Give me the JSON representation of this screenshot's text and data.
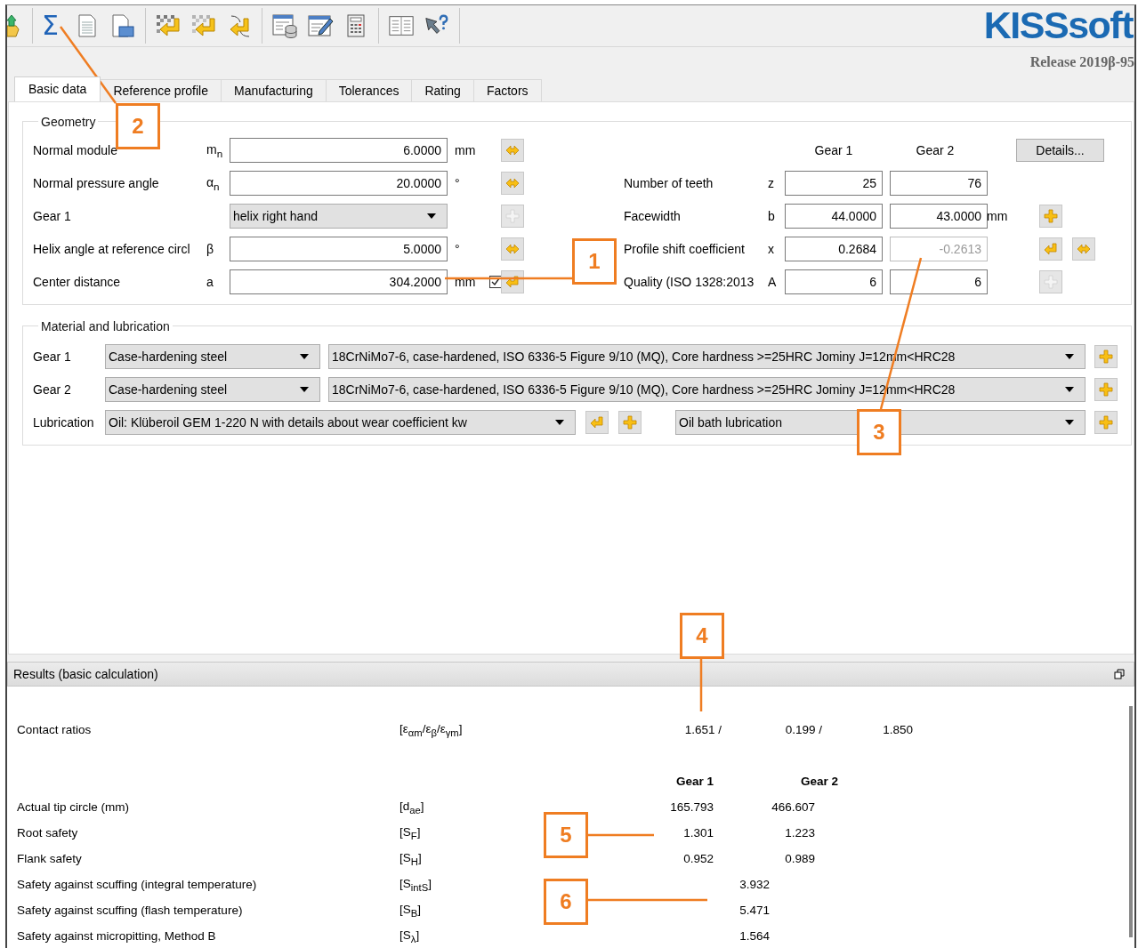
{
  "toolbar": [
    {
      "kind": "upload"
    },
    {
      "kind": "separator"
    },
    {
      "kind": "text",
      "text": "Σ"
    },
    {
      "kind": "document"
    },
    {
      "kind": "save"
    },
    {
      "kind": "separator"
    },
    {
      "kind": "import-checker"
    },
    {
      "kind": "import-fade"
    },
    {
      "kind": "return-curve"
    },
    {
      "kind": "separator"
    },
    {
      "kind": "database"
    },
    {
      "kind": "edit"
    },
    {
      "kind": "calculator"
    },
    {
      "kind": "separator"
    },
    {
      "kind": "book"
    },
    {
      "kind": "help"
    }
  ],
  "logo": "KISSsoft",
  "release": "Release 2019β-95",
  "tabs": [
    {
      "label": "Basic data",
      "selected": true
    },
    {
      "label": "Reference profile",
      "selected": false
    },
    {
      "label": "Manufacturing",
      "selected": false
    },
    {
      "label": "Tolerances",
      "selected": false
    },
    {
      "label": "Rating",
      "selected": false
    },
    {
      "label": "Factors",
      "selected": false
    }
  ],
  "geometry": {
    "legend": "Geometry",
    "left": [
      {
        "label": "Normal module",
        "symbol": "m$_{n}$",
        "kind": "input",
        "value": "6.0000",
        "unit": "mm",
        "button": {
          "kind": "swap",
          "disabled": false
        }
      },
      {
        "label": "Normal pressure angle",
        "symbol": "α$_{n}$",
        "kind": "input",
        "value": "20.0000",
        "unit": "°",
        "button": {
          "kind": "swap",
          "disabled": false
        }
      },
      {
        "label": "Gear 1",
        "kind": "select",
        "value": "helix right hand",
        "button": {
          "kind": "plus",
          "disabled": true
        }
      },
      {
        "label": "Helix angle at reference circl",
        "symbol": "β",
        "kind": "input",
        "value": "5.0000",
        "unit": "°",
        "button": {
          "kind": "swap",
          "disabled": false
        }
      },
      {
        "label": "Center distance",
        "symbol": "a",
        "kind": "input",
        "value": "304.2000",
        "unit": "mm",
        "checkbox": {
          "checked": true
        },
        "button": {
          "kind": "return",
          "disabled": false
        }
      }
    ],
    "columns": [
      "Gear 1",
      "Gear 2"
    ],
    "details": "Details...",
    "right": [
      {
        "label": "Number of teeth",
        "symbol": "z",
        "values": [
          {
            "text": "25",
            "disabled": false
          },
          {
            "text": "76",
            "disabled": false
          }
        ]
      },
      {
        "label": "Facewidth",
        "symbol": "b",
        "values": [
          {
            "text": "44.0000",
            "disabled": false
          },
          {
            "text": "43.0000",
            "disabled": false
          }
        ],
        "unit": "mm",
        "buttons": [
          {
            "kind": "plus",
            "disabled": false
          }
        ]
      },
      {
        "label": "Profile shift coefficient",
        "symbol": "x",
        "values": [
          {
            "text": "0.2684",
            "disabled": false
          },
          {
            "text": "-0.2613",
            "disabled": true
          }
        ],
        "buttons": [
          {
            "kind": "return",
            "disabled": false
          },
          {
            "kind": "swap",
            "disabled": false
          }
        ]
      },
      {
        "label": "Quality (ISO 1328:2013",
        "symbol": "A",
        "values": [
          {
            "text": "6",
            "disabled": false
          },
          {
            "text": "6",
            "disabled": false
          }
        ],
        "buttons": [
          {
            "kind": "plus",
            "disabled": true
          }
        ]
      }
    ]
  },
  "material": {
    "legend": "Material and lubrication",
    "rows": [
      {
        "label": "Gear 1",
        "kind": "material",
        "selects": [
          "Case-hardening steel",
          "18CrNiMo7-6, case-hardened, ISO 6336-5 Figure 9/10 (MQ), Core hardness >=25HRC Jominy J=12mm<HRC28"
        ]
      },
      {
        "label": "Gear 2",
        "kind": "material",
        "selects": [
          "Case-hardening steel",
          "18CrNiMo7-6, case-hardened, ISO 6336-5 Figure 9/10 (MQ), Core hardness >=25HRC Jominy J=12mm<HRC28"
        ]
      },
      {
        "label": "Lubrication",
        "kind": "lubrication",
        "selects": [
          "Oil: Klüberoil GEM 1-220 N with details about wear coefficient kw",
          "Oil bath lubrication"
        ]
      }
    ]
  },
  "results": {
    "title": "Results (basic calculation)",
    "contact": {
      "label": "Contact ratios",
      "symbol": "[ε$_{αm}$/ε$_{β}$/ε$_{γm}$]",
      "values": [
        "1.651 /",
        "0.199 /",
        "1.850"
      ]
    },
    "columns": [
      "Gear 1",
      "Gear 2"
    ],
    "rows": [
      {
        "label": "Actual tip circle (mm)",
        "symbol": "[d$_{ae}$]",
        "values": [
          "165.793",
          "466.607"
        ]
      },
      {
        "label": "Root safety",
        "symbol": "[S$_{F}$]",
        "values": [
          "1.301",
          "1.223"
        ]
      },
      {
        "label": "Flank safety",
        "symbol": "[S$_{H}$]",
        "values": [
          "0.952",
          "0.989"
        ]
      },
      {
        "label": "Safety against scuffing (integral temperature)",
        "symbol": "[S$_{intS}$]",
        "values": [
          "3.932"
        ]
      },
      {
        "label": "Safety against scuffing (flash temperature)",
        "symbol": "[S$_{B}$]",
        "values": [
          "5.471"
        ]
      },
      {
        "label": "Safety against micropitting, Method B",
        "symbol": "[S$_{λ}$]",
        "values": [
          "1.564"
        ]
      }
    ]
  },
  "callouts": [
    "1",
    "2",
    "3",
    "4",
    "5",
    "6"
  ]
}
